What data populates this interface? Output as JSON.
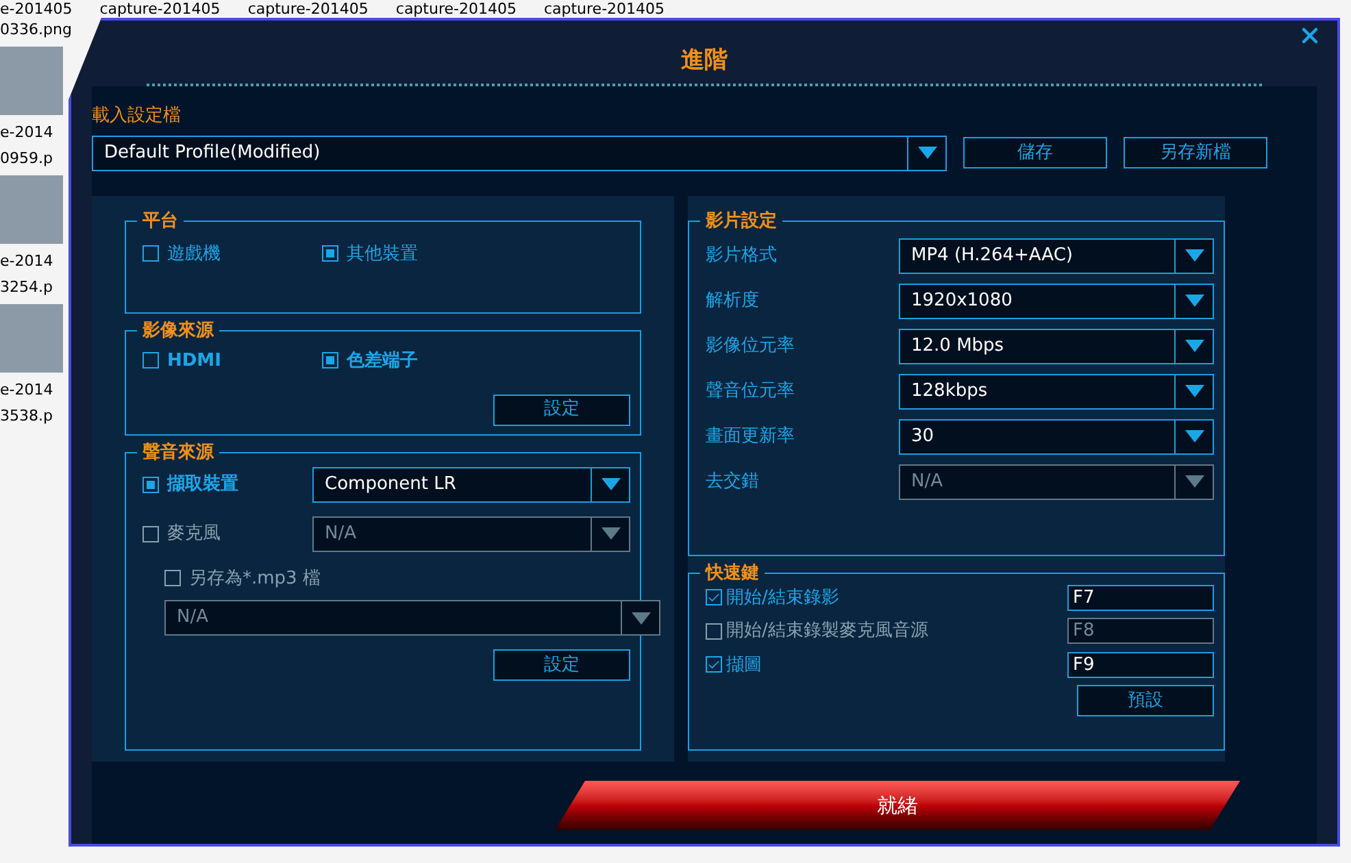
{
  "desktop": {
    "top_labels": [
      "e-201405",
      "capture-201405",
      "capture-201405",
      "capture-201405",
      "capture-201405"
    ],
    "side_labels": [
      "0336.png",
      "e-2014",
      "0959.p",
      "e-2014",
      "3254.p",
      "e-2014",
      "3538.p"
    ]
  },
  "dialog": {
    "title": "進階",
    "profile": {
      "label": "載入設定檔",
      "value": "Default Profile(Modified)",
      "buttons": [
        "儲存",
        "另存新檔"
      ]
    },
    "platform": {
      "title": "平台",
      "options": [
        {
          "label": "遊戲機",
          "selected": false
        },
        {
          "label": "其他裝置",
          "selected": true
        }
      ]
    },
    "video_source": {
      "title": "影像來源",
      "options": [
        {
          "label": "HDMI",
          "selected": false
        },
        {
          "label": "色差端子",
          "selected": true
        }
      ],
      "button": "設定"
    },
    "audio_source": {
      "title": "聲音來源",
      "rows": [
        {
          "kind": "radio",
          "label": "擷取裝置",
          "selected": true,
          "value": "Component LR",
          "disabled": false
        },
        {
          "kind": "radio",
          "label": "麥克風",
          "selected": false,
          "value": "N/A",
          "disabled": true
        },
        {
          "kind": "check",
          "label": "另存為*.mp3 檔",
          "checked": false,
          "value": "N/A",
          "disabled": true
        }
      ],
      "button": "設定"
    },
    "video_settings": {
      "title": "影片設定",
      "rows": [
        {
          "label": "影片格式",
          "value": "MP4 (H.264+AAC)",
          "disabled": false
        },
        {
          "label": "解析度",
          "value": "1920x1080",
          "disabled": false
        },
        {
          "label": "影像位元率",
          "value": "12.0 Mbps",
          "disabled": false
        },
        {
          "label": "聲音位元率",
          "value": "128kbps",
          "disabled": false
        },
        {
          "label": "畫面更新率",
          "value": "30",
          "disabled": false
        },
        {
          "label": "去交錯",
          "value": "N/A",
          "disabled": true
        }
      ]
    },
    "hotkeys": {
      "title": "快速鍵",
      "rows": [
        {
          "label": "開始/結束錄影",
          "checked": true,
          "key": "F7",
          "disabled": false
        },
        {
          "label": "開始/結束錄製麥克風音源",
          "checked": false,
          "key": "F8",
          "disabled": true
        },
        {
          "label": "擷圖",
          "checked": true,
          "key": "F9",
          "disabled": false
        }
      ],
      "button": "預設"
    },
    "ready_button": "就緒"
  }
}
